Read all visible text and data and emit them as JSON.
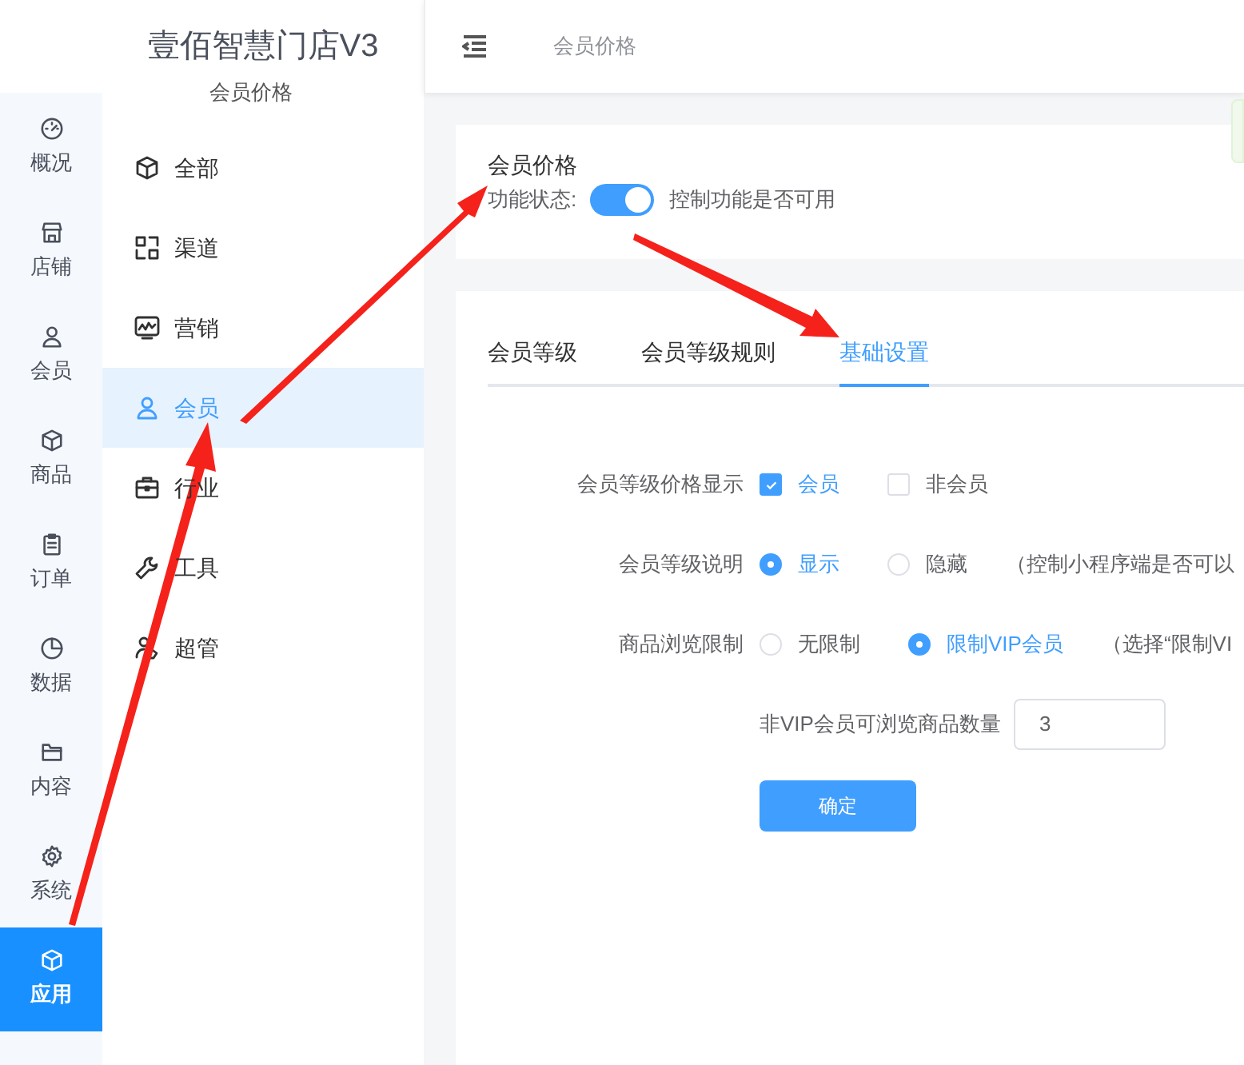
{
  "brand": {
    "title": "壹佰智慧门店V3",
    "subtitle": "会员价格"
  },
  "topbar": {
    "breadcrumb": "会员价格"
  },
  "rail": [
    {
      "label": "概况",
      "selected": false
    },
    {
      "label": "店铺",
      "selected": false
    },
    {
      "label": "会员",
      "selected": false
    },
    {
      "label": "商品",
      "selected": false
    },
    {
      "label": "订单",
      "selected": false
    },
    {
      "label": "数据",
      "selected": false
    },
    {
      "label": "内容",
      "selected": false
    },
    {
      "label": "系统",
      "selected": false
    },
    {
      "label": "应用",
      "selected": true
    }
  ],
  "menu": [
    {
      "label": "全部",
      "selected": false
    },
    {
      "label": "渠道",
      "selected": false
    },
    {
      "label": "营销",
      "selected": false
    },
    {
      "label": "会员",
      "selected": true
    },
    {
      "label": "行业",
      "selected": false
    },
    {
      "label": "工具",
      "selected": false
    },
    {
      "label": "超管",
      "selected": false
    }
  ],
  "feature": {
    "title": "会员价格",
    "status_label": "功能状态:",
    "on": true,
    "hint": "控制功能是否可用"
  },
  "tabs": [
    {
      "label": "会员等级",
      "selected": false
    },
    {
      "label": "会员等级规则",
      "selected": false
    },
    {
      "label": "基础设置",
      "selected": true
    }
  ],
  "form": {
    "rows": [
      {
        "kind": "checkbox",
        "label": "会员等级价格显示",
        "options": [
          {
            "label": "会员",
            "checked": true
          },
          {
            "label": "非会员",
            "checked": false
          }
        ]
      },
      {
        "kind": "radio",
        "label": "会员等级说明",
        "options": [
          {
            "label": "显示",
            "selected": true
          },
          {
            "label": "隐藏",
            "selected": false
          }
        ],
        "note": "（控制小程序端是否可以"
      },
      {
        "kind": "radio",
        "label": "商品浏览限制",
        "options": [
          {
            "label": "无限制",
            "selected": false
          },
          {
            "label": "限制VIP会员",
            "selected": true
          }
        ],
        "note": "（选择“限制VI"
      },
      {
        "kind": "input",
        "label": "非VIP会员可浏览商品数量",
        "value": "3"
      }
    ],
    "submit": "确定"
  }
}
